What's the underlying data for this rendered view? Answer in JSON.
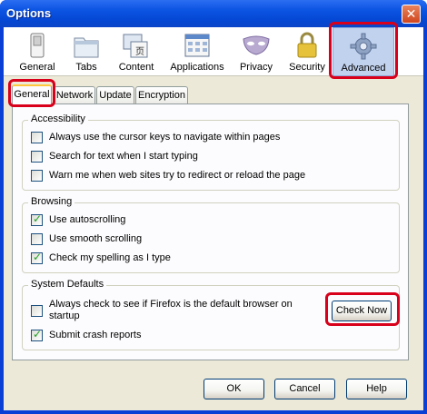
{
  "window": {
    "title": "Options"
  },
  "panes": [
    {
      "label": "General",
      "icon": "switch-icon"
    },
    {
      "label": "Tabs",
      "icon": "tabs-icon"
    },
    {
      "label": "Content",
      "icon": "content-icon"
    },
    {
      "label": "Applications",
      "icon": "applications-icon"
    },
    {
      "label": "Privacy",
      "icon": "mask-icon"
    },
    {
      "label": "Security",
      "icon": "lock-icon"
    },
    {
      "label": "Advanced",
      "icon": "gear-icon",
      "selected": true
    }
  ],
  "tabs": [
    {
      "label": "General",
      "active": true
    },
    {
      "label": "Network"
    },
    {
      "label": "Update"
    },
    {
      "label": "Encryption"
    }
  ],
  "accessibility": {
    "title": "Accessibility",
    "items": [
      {
        "label": "Always use the cursor keys to navigate within pages",
        "checked": false
      },
      {
        "label": "Search for text when I start typing",
        "checked": false
      },
      {
        "label": "Warn me when web sites try to redirect or reload the page",
        "checked": false
      }
    ]
  },
  "browsing": {
    "title": "Browsing",
    "items": [
      {
        "label": "Use autoscrolling",
        "checked": true
      },
      {
        "label": "Use smooth scrolling",
        "checked": false
      },
      {
        "label": "Check my spelling as I type",
        "checked": true
      }
    ]
  },
  "system_defaults": {
    "title": "System Defaults",
    "default_browser_line1": "Always check to see if Firefox is the default browser on",
    "default_browser_line2": "startup",
    "default_browser_checked": false,
    "crash_reports": "Submit crash reports",
    "crash_reports_checked": true,
    "check_now": "Check Now"
  },
  "footer": {
    "ok": "OK",
    "cancel": "Cancel",
    "help": "Help"
  },
  "colors": {
    "highlight": "#d8001a",
    "titlebar": "#0548d6",
    "face": "#ece9d8"
  }
}
